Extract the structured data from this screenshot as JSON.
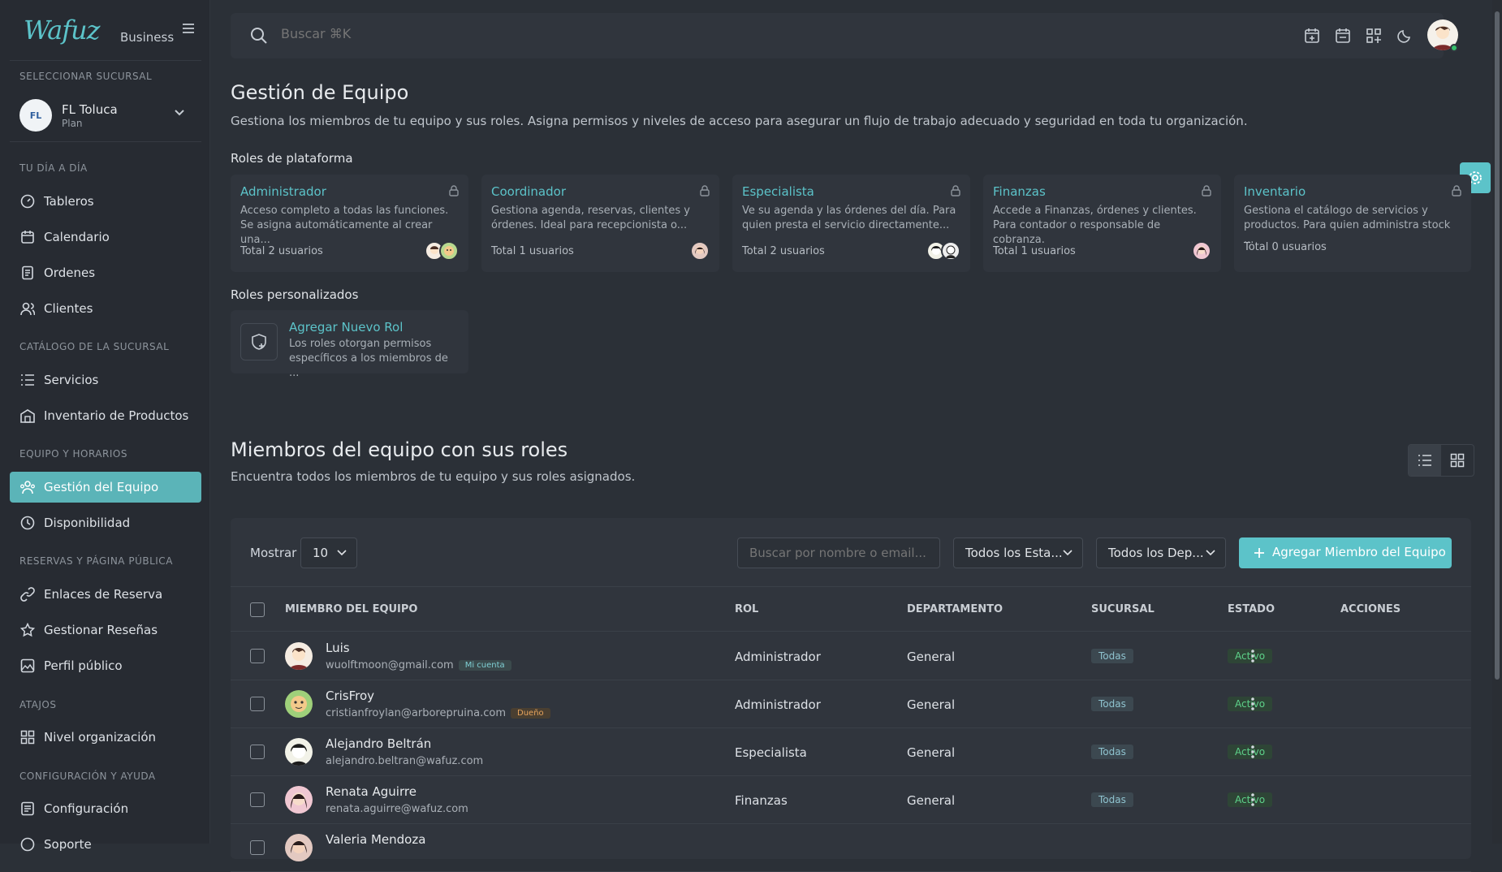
{
  "brand": {
    "logo": "Wafuz",
    "sub": "Business"
  },
  "branch": {
    "section": "SELECCIONAR SUCURSAL",
    "initials": "FL",
    "name": "FL Toluca",
    "plan": "Plan"
  },
  "sidebar": {
    "sections": [
      "TU DÍA A DÍA",
      "CATÁLOGO DE LA SUCURSAL",
      "EQUIPO Y HORARIOS",
      "RESERVAS Y PÁGINA PÚBLICA",
      "ATAJOS",
      "CONFIGURACIÓN Y AYUDA"
    ],
    "items": [
      {
        "label": "Tableros",
        "icon": "dashboard-icon"
      },
      {
        "label": "Calendario",
        "icon": "calendar-icon"
      },
      {
        "label": "Ordenes",
        "icon": "orders-icon"
      },
      {
        "label": "Clientes",
        "icon": "users-icon"
      },
      {
        "label": "Servicios",
        "icon": "list-icon"
      },
      {
        "label": "Inventario de Productos",
        "icon": "store-icon"
      },
      {
        "label": "Gestión del Equipo",
        "icon": "team-icon",
        "active": true
      },
      {
        "label": "Disponibilidad",
        "icon": "clock-icon"
      },
      {
        "label": "Enlaces de Reserva",
        "icon": "link-icon"
      },
      {
        "label": "Gestionar Reseñas",
        "icon": "star-icon"
      },
      {
        "label": "Perfil público",
        "icon": "image-icon"
      },
      {
        "label": "Nivel organización",
        "icon": "grid-icon"
      },
      {
        "label": "Configuración",
        "icon": "settings-icon"
      },
      {
        "label": "Soporte",
        "icon": "help-icon"
      }
    ]
  },
  "search": {
    "placeholder": "Buscar ⌘K"
  },
  "page": {
    "title": "Gestión de Equipo",
    "description": "Gestiona los miembros de tu equipo y sus roles. Asigna permisos y niveles de acceso para asegurar un flujo de trabajo adecuado y seguridad en toda tu organización.",
    "platform_roles_title": "Roles de plataforma",
    "custom_roles_title": "Roles personalizados"
  },
  "roles": [
    {
      "title": "Administrador",
      "desc": "Acceso completo a todas las funciones. Se asigna automáticamente al crear una...",
      "total": "Total 2 usuarios"
    },
    {
      "title": "Coordinador",
      "desc": "Gestiona agenda, reservas, clientes y órdenes. Ideal para recepcionista o...",
      "total": "Total 1 usuarios"
    },
    {
      "title": "Especialista",
      "desc": "Ve su agenda y las órdenes del día. Para quien presta el servicio directamente...",
      "total": "Total 2 usuarios"
    },
    {
      "title": "Finanzas",
      "desc": "Accede a Finanzas, órdenes y clientes. Para contador o responsable de cobranza.",
      "total": "Total 1 usuarios"
    },
    {
      "title": "Inventario",
      "desc": "Gestiona el catálogo de servicios y productos. Para quien administra stock ...",
      "total": "Total 0 usuarios"
    }
  ],
  "add_role": {
    "title": "Agregar Nuevo Rol",
    "desc": "Los roles otorgan permisos específicos a los miembros de ..."
  },
  "members": {
    "title": "Miembros del equipo con sus roles",
    "description": "Encuentra todos los miembros de tu equipo y sus roles asignados.",
    "show_label": "Mostrar",
    "page_size": "10",
    "search_placeholder": "Buscar por nombre o email...",
    "filter_status": "Todos los Esta...",
    "filter_dept": "Todos los Dep...",
    "add_button": "Agregar Miembro del Equipo",
    "columns": [
      "MIEMBRO DEL EQUIPO",
      "ROL",
      "DEPARTAMENTO",
      "SUCURSAL",
      "ESTADO",
      "ACCIONES"
    ],
    "rows": [
      {
        "name": "Luis",
        "email": "wuolftmoon@gmail.com",
        "tag": "Mi cuenta",
        "role": "Administrador",
        "dept": "General",
        "branch": "Todas",
        "status": "Activo"
      },
      {
        "name": "CrisFroy",
        "email": "cristianfroylan@arborepruina.com",
        "tag": "Dueño",
        "role": "Administrador",
        "dept": "General",
        "branch": "Todas",
        "status": "Activo"
      },
      {
        "name": "Alejandro Beltrán",
        "email": "alejandro.beltran@wafuz.com",
        "tag": "",
        "role": "Especialista",
        "dept": "General",
        "branch": "Todas",
        "status": "Activo"
      },
      {
        "name": "Renata Aguirre",
        "email": "renata.aguirre@wafuz.com",
        "tag": "",
        "role": "Finanzas",
        "dept": "General",
        "branch": "Todas",
        "status": "Activo"
      },
      {
        "name": "Valeria Mendoza",
        "email": "",
        "tag": "",
        "role": "",
        "dept": "",
        "branch": "",
        "status": ""
      }
    ]
  },
  "colors": {
    "accent": "#5cc3c9",
    "bg": "#2b3037",
    "panel": "#30353d",
    "active": "#5ed28a"
  }
}
